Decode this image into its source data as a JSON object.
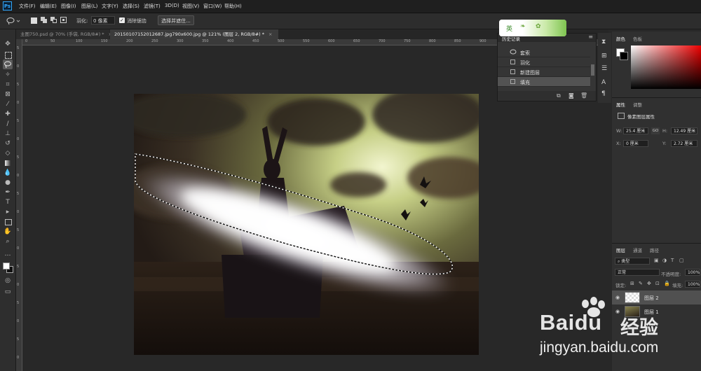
{
  "app": {
    "logo_text": "Ps"
  },
  "menu": [
    "文件(F)",
    "编辑(E)",
    "图像(I)",
    "图层(L)",
    "文字(Y)",
    "选择(S)",
    "滤镜(T)",
    "3D(D)",
    "视图(V)",
    "窗口(W)",
    "帮助(H)"
  ],
  "options": {
    "feather_label": "羽化:",
    "feather_value": "0 像素",
    "antialias_label": "消除锯齿",
    "antialias_checked": true,
    "select_mask_label": "选择并遮住..."
  },
  "tabs": [
    {
      "label": "主图750.psd @ 70% (手袋, RGB/8#) *",
      "active": false,
      "close": "×"
    },
    {
      "label": "20150107152012687.jpg790x600.jpg @ 121% (图层 2, RGB/8#) *",
      "active": true,
      "close": "×"
    }
  ],
  "ruler_top": [
    "0",
    "50",
    "100",
    "150",
    "200",
    "250",
    "300",
    "350",
    "400",
    "450",
    "500",
    "550",
    "600",
    "650",
    "700",
    "750",
    "800",
    "850",
    "900",
    "950",
    "1000",
    "1050",
    "1100"
  ],
  "ruler_left": [
    "5",
    "0",
    "5",
    "0",
    "5",
    "0",
    "5",
    "0",
    "5",
    "0",
    "5",
    "0",
    "5",
    "0",
    "5",
    "0",
    "5",
    "0"
  ],
  "history": {
    "tabs": [
      "历史记录"
    ],
    "items": [
      {
        "label": "套索",
        "icon": "lasso-icon",
        "selected": false
      },
      {
        "label": "羽化",
        "icon": "history-step-icon",
        "selected": false
      },
      {
        "label": "新建图层",
        "icon": "history-step-icon",
        "selected": false
      },
      {
        "label": "填充",
        "icon": "history-step-icon",
        "selected": true
      }
    ]
  },
  "color_panel": {
    "tabs": [
      "颜色",
      "色板"
    ]
  },
  "properties_panel": {
    "tabs": [
      "属性",
      "调整"
    ],
    "title": "像素图层属性",
    "w_label": "W:",
    "w_value": "25.4 厘米",
    "h_label": "H:",
    "h_value": "12.49 厘米",
    "link_label": "GO",
    "x_label": "X:",
    "x_value": "0 厘米",
    "y_label": "Y:",
    "y_value": "2.72 厘米"
  },
  "layers_panel": {
    "tabs": [
      "图层",
      "通道",
      "路径"
    ],
    "filter_label": "类型",
    "blend_mode": "正常",
    "opacity_label": "不透明度:",
    "opacity_value": "100%",
    "lock_label": "锁定:",
    "fill_label": "填充:",
    "fill_value": "100%",
    "layers": [
      {
        "name": "图层 2",
        "selected": true
      },
      {
        "name": "图层 1",
        "selected": false
      }
    ]
  },
  "watermark": {
    "brand": "Bai",
    "brand2": "du",
    "cn": "经验",
    "url": "jingyan.baidu.com"
  },
  "translate_badge": {
    "label": "英"
  },
  "colors": {
    "accent": "#31a8ff",
    "selection": "#5a5a5a"
  }
}
